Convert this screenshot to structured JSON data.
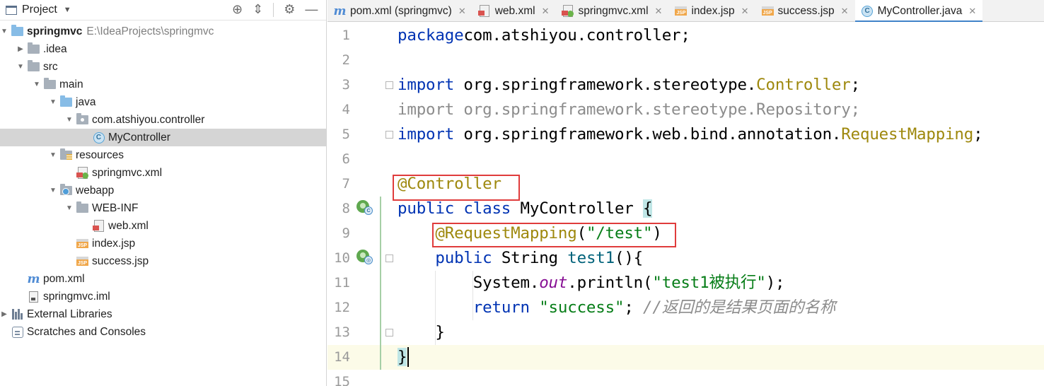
{
  "project_pane": {
    "title": "Project",
    "tree": [
      {
        "label": "springmvc",
        "path": "E:\\IdeaProjects\\springmvc",
        "icon": "module-folder-icon",
        "depth": 0,
        "arrow": "expanded"
      },
      {
        "label": ".idea",
        "icon": "folder-icon",
        "depth": 1,
        "arrow": "collapsed"
      },
      {
        "label": "src",
        "icon": "folder-icon",
        "depth": 1,
        "arrow": "expanded"
      },
      {
        "label": "main",
        "icon": "folder-icon",
        "depth": 2,
        "arrow": "expanded"
      },
      {
        "label": "java",
        "icon": "source-folder-icon",
        "depth": 3,
        "arrow": "expanded"
      },
      {
        "label": "com.atshiyou.controller",
        "icon": "package-icon",
        "depth": 4,
        "arrow": "expanded"
      },
      {
        "label": "MyController",
        "icon": "java-class-icon",
        "depth": 5,
        "arrow": "none",
        "selected": true
      },
      {
        "label": "resources",
        "icon": "resources-folder-icon",
        "depth": 3,
        "arrow": "expanded"
      },
      {
        "label": "springmvc.xml",
        "icon": "spring-xml-icon",
        "depth": 4,
        "arrow": "none"
      },
      {
        "label": "webapp",
        "icon": "web-folder-icon",
        "depth": 3,
        "arrow": "expanded"
      },
      {
        "label": "WEB-INF",
        "icon": "folder-icon",
        "depth": 4,
        "arrow": "expanded"
      },
      {
        "label": "web.xml",
        "icon": "xml-icon",
        "depth": 5,
        "arrow": "none"
      },
      {
        "label": "index.jsp",
        "icon": "jsp-icon",
        "depth": 4,
        "arrow": "none"
      },
      {
        "label": "success.jsp",
        "icon": "jsp-icon",
        "depth": 4,
        "arrow": "none"
      },
      {
        "label": "pom.xml",
        "icon": "maven-icon",
        "depth": 1,
        "arrow": "none"
      },
      {
        "label": "springmvc.iml",
        "icon": "iml-icon",
        "depth": 1,
        "arrow": "none"
      },
      {
        "label": "External Libraries",
        "icon": "libraries-icon",
        "depth": 0,
        "arrow": "collapsed"
      },
      {
        "label": "Scratches and Consoles",
        "icon": "scratches-icon",
        "depth": 0,
        "arrow": "none"
      }
    ]
  },
  "tabs": [
    {
      "label": "pom.xml (springmvc)",
      "icon": "maven-icon",
      "active": false
    },
    {
      "label": "web.xml",
      "icon": "xml-icon",
      "active": false
    },
    {
      "label": "springmvc.xml",
      "icon": "spring-xml-icon",
      "active": false
    },
    {
      "label": "index.jsp",
      "icon": "jsp-icon",
      "active": false
    },
    {
      "label": "success.jsp",
      "icon": "jsp-icon",
      "active": false
    },
    {
      "label": "MyController.java",
      "icon": "java-class-icon",
      "active": true
    }
  ],
  "editor": {
    "lines": [
      {
        "n": "1",
        "tokens": [
          [
            "kw",
            "package"
          ],
          [
            "",
            "com.atshiyou.controller;"
          ]
        ]
      },
      {
        "n": "2",
        "tokens": []
      },
      {
        "n": "3",
        "tokens": [
          [
            "kw",
            "import"
          ],
          [
            "",
            " org.springframework.stereotype."
          ],
          [
            "ann",
            "Controller"
          ],
          [
            "",
            ";"
          ]
        ]
      },
      {
        "n": "4",
        "tokens": [
          [
            "unused",
            "import org.springframework.stereotype.Repository;"
          ]
        ]
      },
      {
        "n": "5",
        "tokens": [
          [
            "kw",
            "import"
          ],
          [
            "",
            " org.springframework.web.bind.annotation."
          ],
          [
            "ann",
            "RequestMapping"
          ],
          [
            "",
            ";"
          ]
        ]
      },
      {
        "n": "6",
        "tokens": []
      },
      {
        "n": "7",
        "tokens": [
          [
            "ann",
            "@Controller"
          ]
        ]
      },
      {
        "n": "8",
        "tokens": [
          [
            "kw",
            "public class"
          ],
          [
            "",
            " MyController "
          ],
          [
            "brace",
            "{"
          ]
        ]
      },
      {
        "n": "9",
        "tokens": [
          [
            "",
            "    "
          ],
          [
            "ann",
            "@RequestMapping"
          ],
          [
            "",
            "("
          ],
          [
            "str",
            "\"/test\""
          ],
          [
            "",
            ")"
          ]
        ]
      },
      {
        "n": "10",
        "tokens": [
          [
            "",
            "    "
          ],
          [
            "kw",
            "public"
          ],
          [
            "",
            " String "
          ],
          [
            "fn",
            "test1"
          ],
          [
            "",
            "(){"
          ]
        ]
      },
      {
        "n": "11",
        "tokens": [
          [
            "",
            "        System."
          ],
          [
            "fld",
            "out"
          ],
          [
            "",
            ".println("
          ],
          [
            "str",
            "\"test1被执行\""
          ],
          [
            "",
            ");"
          ]
        ]
      },
      {
        "n": "12",
        "tokens": [
          [
            "",
            "        "
          ],
          [
            "kw",
            "return"
          ],
          [
            "str",
            " \"success\""
          ],
          [
            "",
            "; "
          ],
          [
            "cmt",
            "//返回的是结果页面的名称"
          ]
        ]
      },
      {
        "n": "13",
        "tokens": [
          [
            "",
            "    }"
          ]
        ]
      },
      {
        "n": "14",
        "tokens": [
          [
            "brace",
            "}"
          ]
        ]
      },
      {
        "n": "15",
        "tokens": []
      }
    ]
  },
  "colors": {
    "keyword": "#0033b3",
    "annotation": "#9e880d",
    "string": "#067d17",
    "comment": "#8c8c8c",
    "highlight_box": "#e03c3c",
    "active_tab_underline": "#4083c9",
    "selection": "#d5d5d5"
  }
}
